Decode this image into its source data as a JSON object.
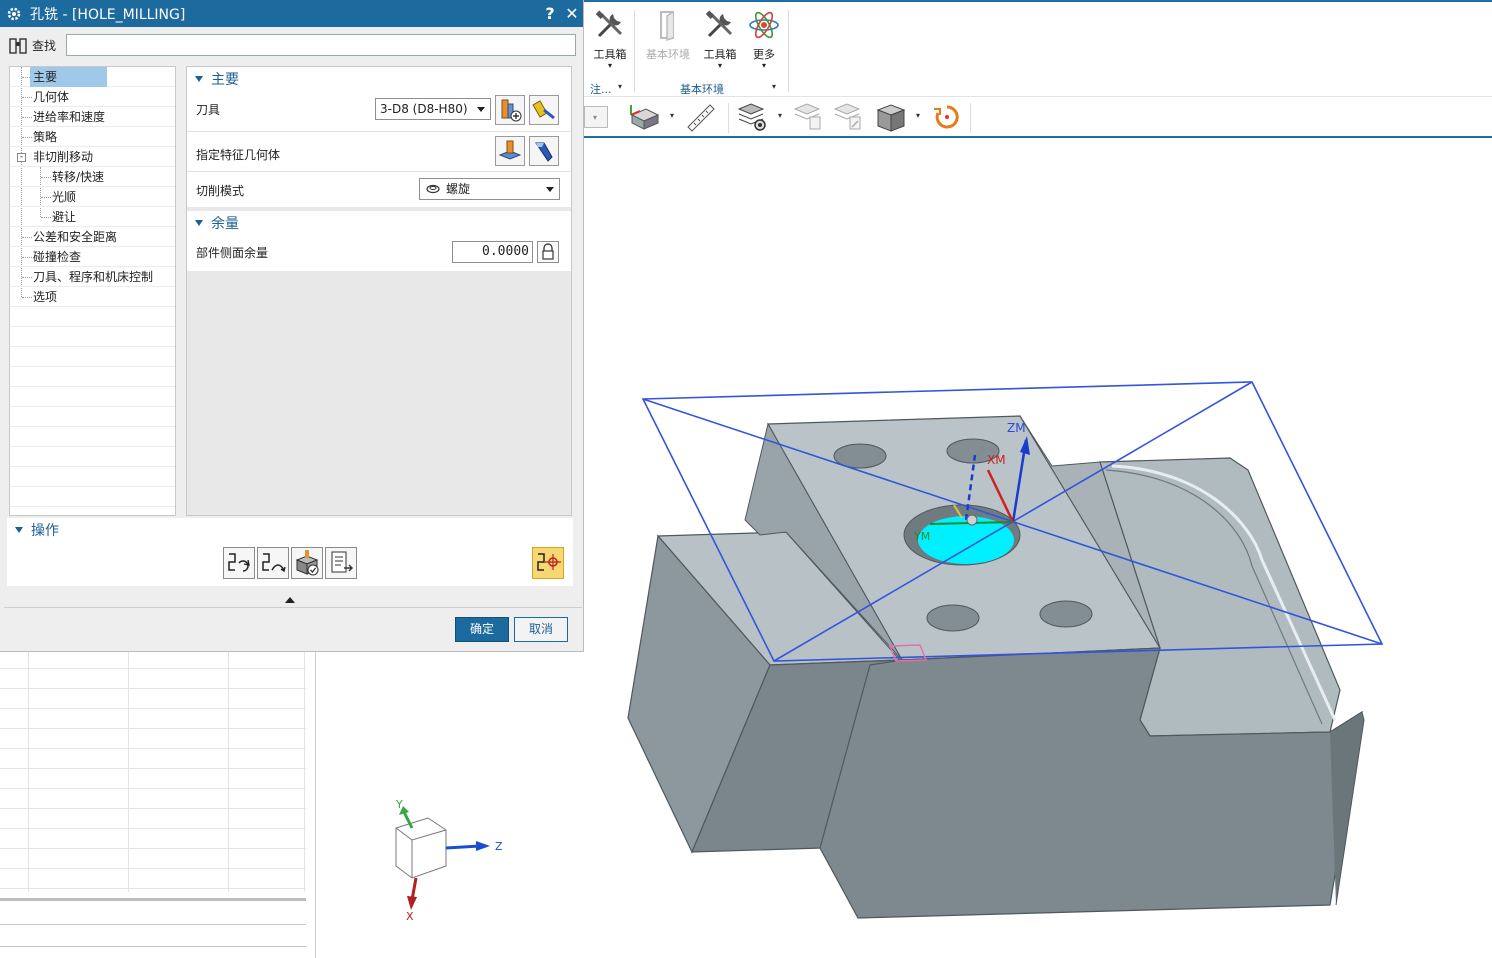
{
  "dialog": {
    "title": "孔铣 - [HOLE_MILLING]",
    "help_label": "?",
    "close_label": "✕",
    "find_label": "查找",
    "find_value": ""
  },
  "tree": {
    "items": [
      {
        "label": "主要",
        "level": 0,
        "selected": true
      },
      {
        "label": "几何体",
        "level": 0
      },
      {
        "label": "进给率和速度",
        "level": 0
      },
      {
        "label": "策略",
        "level": 0
      },
      {
        "label": "非切削移动",
        "level": 0,
        "expander": "-"
      },
      {
        "label": "转移/快速",
        "level": 1
      },
      {
        "label": "光顺",
        "level": 1
      },
      {
        "label": "避让",
        "level": 1
      },
      {
        "label": "公差和安全距离",
        "level": 0
      },
      {
        "label": "碰撞检查",
        "level": 0
      },
      {
        "label": "刀具、程序和机床控制",
        "level": 0
      },
      {
        "label": "选项",
        "level": 0
      }
    ]
  },
  "main": {
    "header": "主要",
    "tool_label": "刀具",
    "tool_value": "3-D8 (D8-H80)",
    "feature_geom_label": "指定特征几何体",
    "cut_mode_label": "切削模式",
    "cut_mode_value": "螺旋"
  },
  "stock": {
    "header": "余量",
    "side_stock_label": "部件侧面余量",
    "side_stock_value": "0.0000"
  },
  "ops": {
    "header": "操作"
  },
  "footer": {
    "ok_label": "确定",
    "cancel_label": "取消"
  },
  "ribbon": {
    "btn1_label": "工具箱",
    "btn2_label": "基本环境",
    "btn3_label": "工具箱",
    "btn4_label": "更多",
    "group1_label": "注...",
    "group2_label": "基本环境"
  },
  "viewport": {
    "triad_y": "Y",
    "triad_z": "Z",
    "triad_x": "X",
    "csys_zm": "ZM",
    "csys_xm": "XM",
    "csys_ym": "YM"
  },
  "colors": {
    "title_bar": "#1d6b9e",
    "accent": "#1d5f94",
    "selection": "#9ec9e9",
    "part_top": "#b4bec3",
    "part_side": "#7e8a90",
    "hole_highlight": "#00f0ff",
    "bbox": "#3355dd"
  }
}
